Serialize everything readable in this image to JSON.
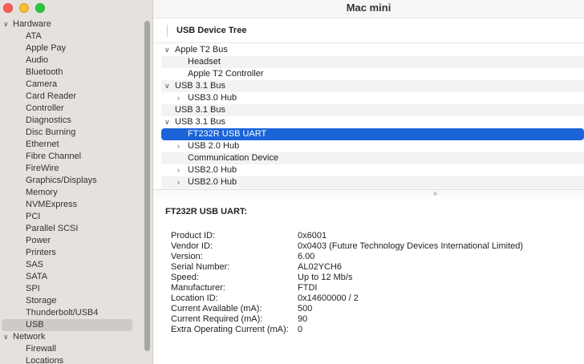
{
  "window": {
    "title": "Mac mini"
  },
  "sidebar": {
    "sections": [
      {
        "label": "Hardware",
        "items": [
          "ATA",
          "Apple Pay",
          "Audio",
          "Bluetooth",
          "Camera",
          "Card Reader",
          "Controller",
          "Diagnostics",
          "Disc Burning",
          "Ethernet",
          "Fibre Channel",
          "FireWire",
          "Graphics/Displays",
          "Memory",
          "NVMExpress",
          "PCI",
          "Parallel SCSI",
          "Power",
          "Printers",
          "SAS",
          "SATA",
          "SPI",
          "Storage",
          "Thunderbolt/USB4",
          "USB"
        ]
      },
      {
        "label": "Network",
        "items": [
          "Firewall",
          "Locations"
        ]
      }
    ],
    "selected": "USB"
  },
  "main": {
    "section_title": "USB Device Tree",
    "tree": [
      {
        "label": "Apple T2 Bus",
        "expanded": true
      },
      {
        "label": "Headset"
      },
      {
        "label": "Apple T2 Controller"
      },
      {
        "label": "USB 3.1 Bus",
        "expanded": true
      },
      {
        "label": "USB3.0 Hub",
        "expanded": false
      },
      {
        "label": "USB 3.1 Bus"
      },
      {
        "label": "USB 3.1 Bus",
        "expanded": true
      },
      {
        "label": "FT232R USB UART",
        "selected": true
      },
      {
        "label": "USB 2.0 Hub",
        "expanded": false
      },
      {
        "label": "Communication Device"
      },
      {
        "label": "USB2.0 Hub",
        "expanded": false
      },
      {
        "label": "USB2.0 Hub",
        "expanded": false
      }
    ],
    "details": {
      "title": "FT232R USB UART:",
      "fields": [
        {
          "key": "Product ID:",
          "value": "0x6001"
        },
        {
          "key": "Vendor ID:",
          "value": "0x0403  (Future Technology Devices International Limited)"
        },
        {
          "key": "Version:",
          "value": "6.00"
        },
        {
          "key": "Serial Number:",
          "value": "AL02YCH6"
        },
        {
          "key": "Speed:",
          "value": "Up to 12 Mb/s"
        },
        {
          "key": "Manufacturer:",
          "value": "FTDI"
        },
        {
          "key": "Location ID:",
          "value": "0x14600000 / 2"
        },
        {
          "key": "Current Available (mA):",
          "value": "500"
        },
        {
          "key": "Current Required (mA):",
          "value": "90"
        },
        {
          "key": "Extra Operating Current (mA):",
          "value": "0"
        }
      ]
    }
  },
  "colors": {
    "selection": "#1b64d8",
    "sidebar_bg": "#e4e1de",
    "sidebar_selected": "#cdcac7"
  },
  "icons": {
    "expanded": "chevron-down-icon",
    "collapsed": "chevron-right-icon"
  }
}
